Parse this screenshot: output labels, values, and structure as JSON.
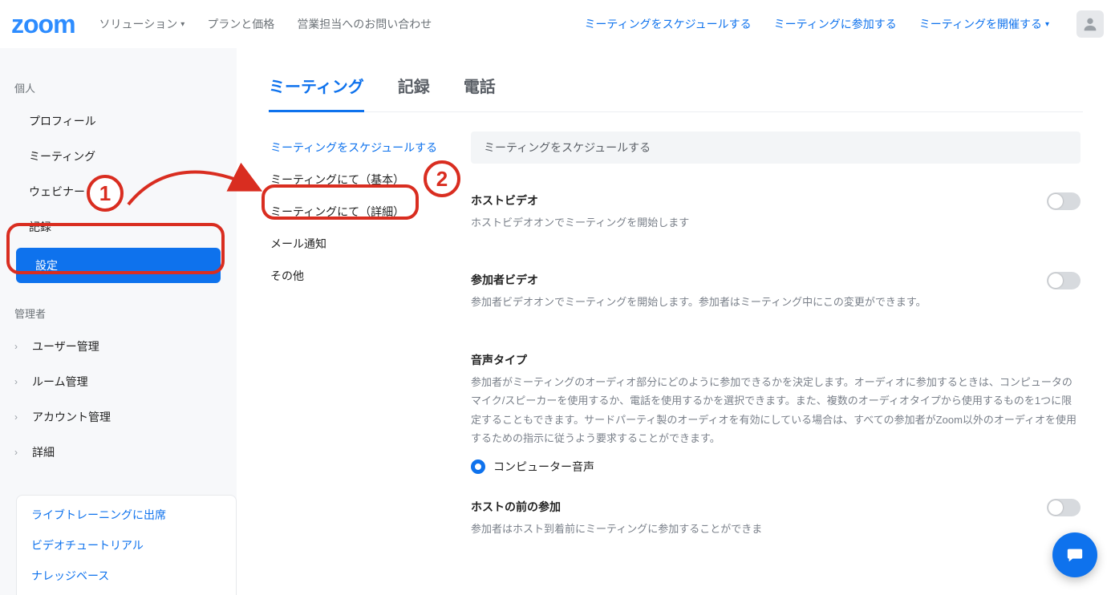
{
  "header": {
    "logo_text": "zoom",
    "left_links": {
      "solutions": "ソリューション",
      "plans": "プランと価格",
      "contact": "営業担当へのお問い合わせ"
    },
    "right_links": {
      "schedule": "ミーティングをスケジュールする",
      "join": "ミーティングに参加する",
      "host": "ミーティングを開催する"
    }
  },
  "sidebar": {
    "personal_label": "個人",
    "personal_items": {
      "profile": "プロフィール",
      "meetings": "ミーティング",
      "webinars": "ウェビナー",
      "recordings": "記録",
      "settings": "設定"
    },
    "admin_label": "管理者",
    "admin_items": {
      "users": "ユーザー管理",
      "rooms": "ルーム管理",
      "account": "アカウント管理",
      "advanced": "詳細"
    },
    "help": {
      "training": "ライブトレーニングに出席",
      "tutorial": "ビデオチュートリアル",
      "kb": "ナレッジベース"
    }
  },
  "content": {
    "tabs": {
      "meeting": "ミーティング",
      "recording": "記録",
      "phone": "電話"
    },
    "subnav": {
      "schedule": "ミーティングをスケジュールする",
      "in_basic": "ミーティングにて（基本）",
      "in_adv": "ミーティングにて（詳細）",
      "email": "メール通知",
      "other": "その他"
    },
    "section_title": "ミーティングをスケジュールする",
    "host_video": {
      "label": "ホストビデオ",
      "desc": "ホストビデオオンでミーティングを開始します"
    },
    "part_video": {
      "label": "参加者ビデオ",
      "desc": "参加者ビデオオンでミーティングを開始します。参加者はミーティング中にこの変更ができます。"
    },
    "audio": {
      "label": "音声タイプ",
      "desc": "参加者がミーティングのオーディオ部分にどのように参加できるかを決定します。オーディオに参加するときは、コンピュータのマイク/スピーカーを使用するか、電話を使用するかを選択できます。また、複数のオーディオタイプから使用するものを1つに限定することもできます。サードパーティ製のオーディオを有効にしている場合は、すべての参加者がZoom以外のオーディオを使用するための指示に従うよう要求することができます。",
      "radio_computer": "コンピューター音声"
    },
    "before_host": {
      "label": "ホストの前の参加",
      "desc": "参加者はホスト到着前にミーティングに参加することができま"
    }
  },
  "annotations": {
    "one": "1",
    "two": "2"
  }
}
